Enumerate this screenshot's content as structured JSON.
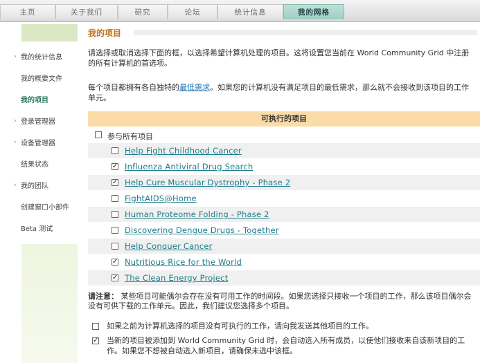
{
  "nav": {
    "tabs": [
      {
        "label": "主页",
        "active": false
      },
      {
        "label": "关于我们",
        "active": false
      },
      {
        "label": "研究",
        "active": false
      },
      {
        "label": "论坛",
        "active": false
      },
      {
        "label": "统计信息",
        "active": false
      },
      {
        "label": "我的网格",
        "active": true
      }
    ]
  },
  "sidebar": {
    "items": [
      {
        "label": "我的统计信息",
        "arrow": true,
        "active": false
      },
      {
        "label": "我的概要文件",
        "arrow": false,
        "active": false
      },
      {
        "label": "我的项目",
        "arrow": false,
        "active": true
      },
      {
        "label": "登录管理器",
        "arrow": true,
        "active": false
      },
      {
        "label": "设备管理器",
        "arrow": true,
        "active": false
      },
      {
        "label": "结果状态",
        "arrow": false,
        "active": false
      },
      {
        "label": "我的团队",
        "arrow": true,
        "active": false
      },
      {
        "label": "创建窗口小部件",
        "arrow": false,
        "active": false
      },
      {
        "label": "Beta 测试",
        "arrow": false,
        "active": false
      }
    ],
    "arrow_glyph": "›"
  },
  "main": {
    "title": "我的项目",
    "intro": "请选择或取消选择下面的框，以选择希望计算机处理的项目。这将设置您当前在 World Community Grid 中注册的所有计算机的首选项。",
    "req_before": "每个项目都拥有各自独特的",
    "req_link": "最低需求",
    "req_after": "。如果您的计算机没有满足项目的最低需求，那么就不会接收到该项目的工作单元。",
    "projects_header": "可执行的项目",
    "all_label": "参与所有项目",
    "all_checked": false,
    "projects": [
      {
        "name": "Help Fight Childhood Cancer",
        "checked": false
      },
      {
        "name": "Influenza Antiviral Drug Search",
        "checked": true
      },
      {
        "name": "Help Cure Muscular Dystrophy - Phase 2",
        "checked": true
      },
      {
        "name": "FightAIDS@Home",
        "checked": false
      },
      {
        "name": "Human Proteome Folding - Phase 2",
        "checked": false
      },
      {
        "name": "Discovering Dengue Drugs - Together",
        "checked": false
      },
      {
        "name": "Help Conquer Cancer",
        "checked": false
      },
      {
        "name": "Nutritious Rice for the World",
        "checked": true
      },
      {
        "name": "The Clean Energy Project",
        "checked": true
      }
    ],
    "note_label": "请注意：",
    "note_text": " 某些项目可能偶尔会存在没有可用工作的时间段。如果您选择只接收一个项目的工作，那么该项目偶尔会没有可供下载的工作单元。因此，我们建议您选择多个项目。",
    "options": [
      {
        "text": "如果之前为计算机选择的项目没有可执行的工作，请向我发送其他项目的工作。",
        "checked": false
      },
      {
        "text": "当新的项目被添加到 World Community Grid 时，会自动选入所有成员，以使他们接收来自该新项目的工作。如果您不想被自动选入新项目，请确保未选中该框。",
        "checked": true
      }
    ],
    "check_glyph": "✓"
  }
}
